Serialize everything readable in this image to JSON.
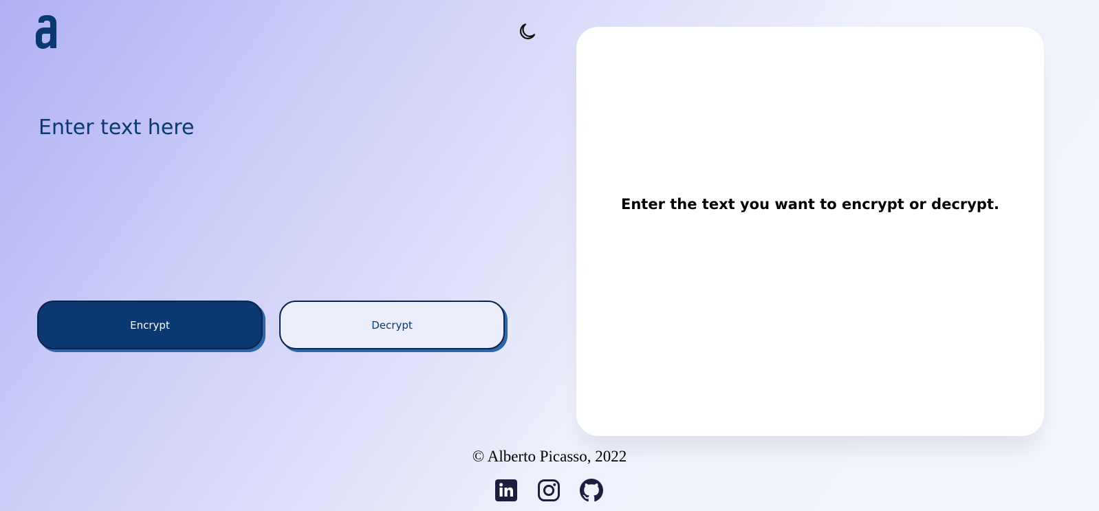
{
  "logo": {
    "icon": "alura-a-logo-icon"
  },
  "theme_toggle": {
    "icon": "moon-icon"
  },
  "input": {
    "placeholder": "Enter text here",
    "value": ""
  },
  "actions": {
    "encrypt_label": "Encrypt",
    "decrypt_label": "Decrypt"
  },
  "output": {
    "message": "Enter the text you want to encrypt or decrypt."
  },
  "footer": {
    "copyright": "© Alberto Picasso, 2022",
    "social": [
      {
        "icon": "linkedin-icon"
      },
      {
        "icon": "instagram-icon"
      },
      {
        "icon": "github-icon"
      }
    ]
  },
  "colors": {
    "accent": "#0a3871",
    "button_shadow": "#2e66a8",
    "card": "#ffffff",
    "gradient_start": "#b0b0f3",
    "gradient_end": "#f2f5fd"
  }
}
